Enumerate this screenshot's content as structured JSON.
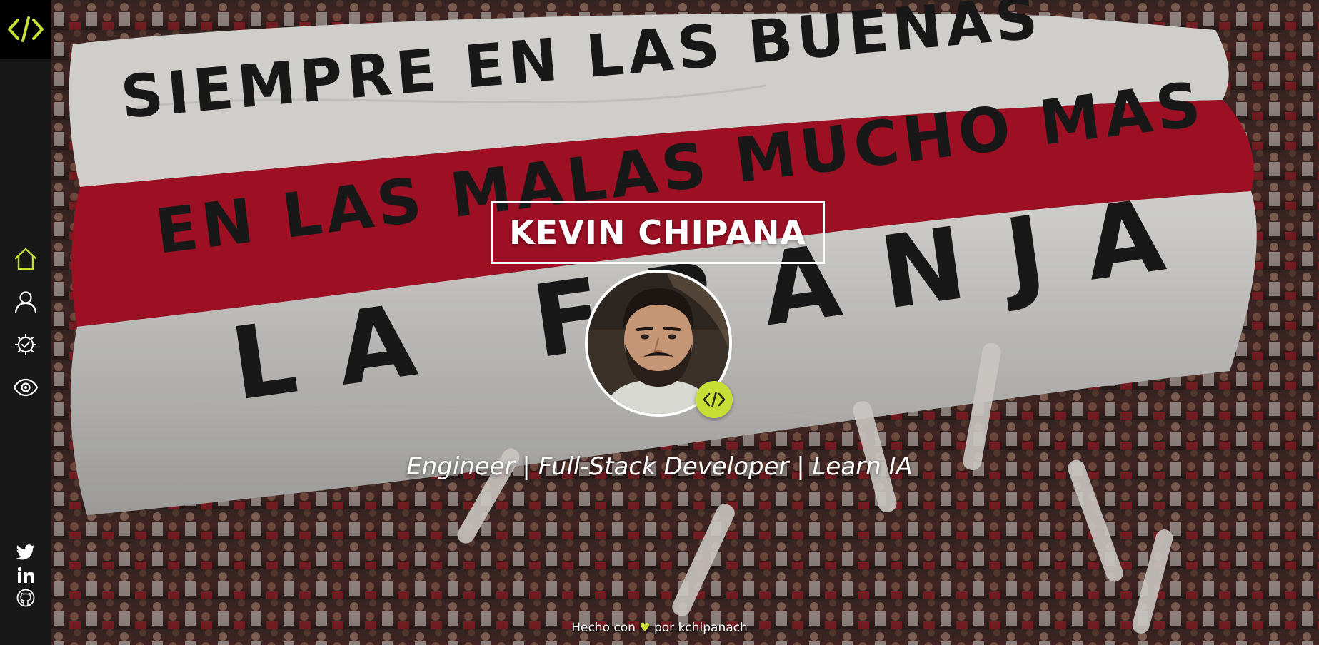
{
  "colors": {
    "accent": "#c7de36",
    "sidebar": "#181818",
    "logo_bg": "#000000",
    "icon": "#ffffff",
    "banner_red": "#b3132a",
    "banner_white": "#ecebe8",
    "banner_text": "#1c1c1c"
  },
  "sidebar": {
    "logo": {
      "icon": "code-brackets-icon",
      "text": "</>"
    },
    "nav": [
      {
        "icon": "home-icon",
        "active": true
      },
      {
        "icon": "user-icon",
        "active": false
      },
      {
        "icon": "gear-check-icon",
        "active": false
      },
      {
        "icon": "eye-icon",
        "active": false
      }
    ],
    "social": [
      {
        "icon": "twitter-icon"
      },
      {
        "icon": "linkedin-icon"
      },
      {
        "icon": "github-icon"
      }
    ]
  },
  "hero": {
    "background": {
      "banner_lines": [
        "SIEMPRE EN LAS BUENAS",
        "EN LAS MALAS MUCHO MAS",
        "LA FRANJA"
      ]
    },
    "name": "KEVIN CHIPANA",
    "avatar": {
      "icon": "profile-photo",
      "badge_icon": "code-brackets-icon",
      "badge_text": "</>"
    },
    "tagline": "Engineer | Full-Stack Developer | Learn IA"
  },
  "footer": {
    "prefix": "Hecho con",
    "heart": "♥",
    "suffix": "por kchipanach"
  }
}
